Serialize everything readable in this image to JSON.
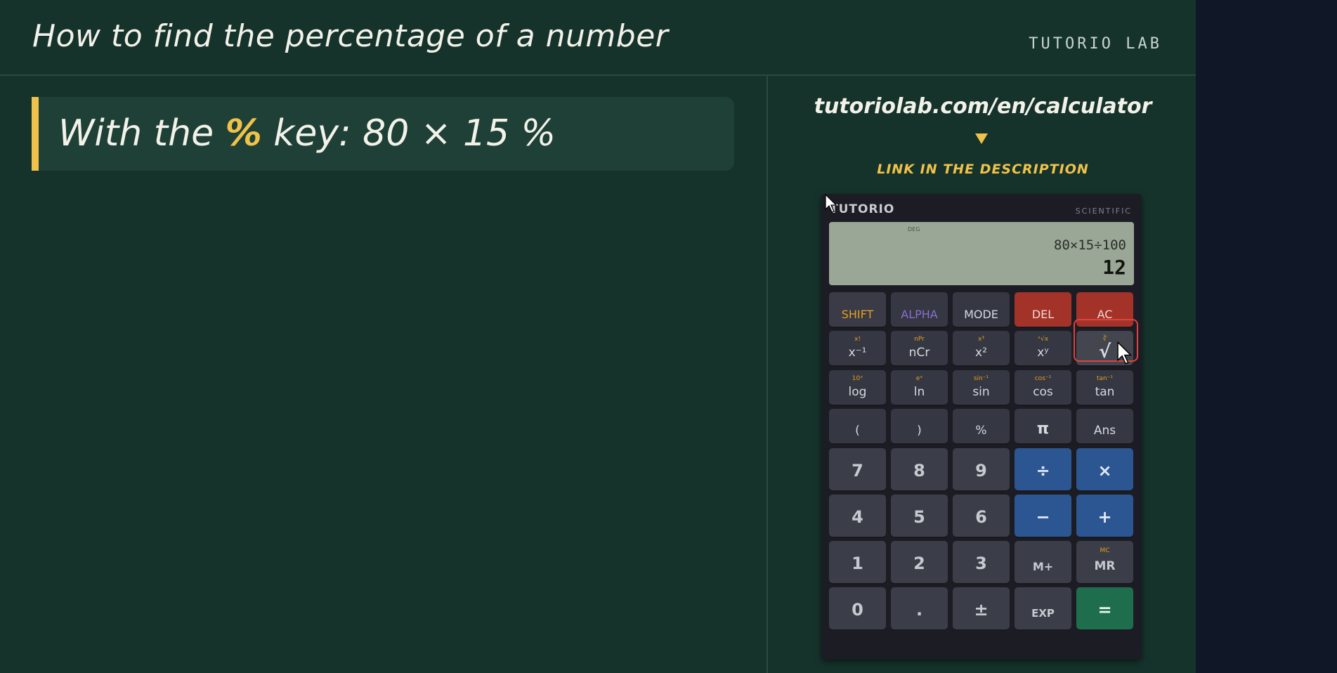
{
  "header": {
    "title": "How to find the percentage of a number",
    "brand": "TUTORIO LAB"
  },
  "formula": {
    "prefix": "With the ",
    "key": "%",
    "suffix": " key: 80 × 15 %"
  },
  "promo": {
    "url": "tutoriolab.com/en/calculator",
    "note": "LINK IN THE DESCRIPTION"
  },
  "calculator": {
    "brand": "TUTORIO",
    "model": "SCIENTIFIC",
    "display": {
      "mode": "DEG",
      "expression": "80×15÷100",
      "result": "12"
    },
    "keys": {
      "shift": "SHIFT",
      "alpha": "ALPHA",
      "mode": "MODE",
      "del": "DEL",
      "ac": "AC",
      "inverse": {
        "main": "x⁻¹",
        "sub": "x!"
      },
      "ncr": {
        "main": "nCr",
        "sub": "nPr"
      },
      "square": {
        "main": "x²",
        "sub": "x³"
      },
      "power": {
        "main": "xʸ",
        "sub": "ˣ√x"
      },
      "sqrt": {
        "main": "√",
        "sub": "∛"
      },
      "log": {
        "main": "log",
        "sub": "10ˣ"
      },
      "ln": {
        "main": "ln",
        "sub": "eˣ"
      },
      "sin": {
        "main": "sin",
        "sub": "sin⁻¹"
      },
      "cos": {
        "main": "cos",
        "sub": "cos⁻¹"
      },
      "tan": {
        "main": "tan",
        "sub": "tan⁻¹"
      },
      "lparen": "(",
      "rparen": ")",
      "percent": "%",
      "pi": "π",
      "ans": "Ans",
      "seven": "7",
      "eight": "8",
      "nine": "9",
      "divide": "÷",
      "multiply": "×",
      "four": "4",
      "five": "5",
      "six": "6",
      "minus": "−",
      "plus": "+",
      "one": "1",
      "two": "2",
      "three": "3",
      "mplus": "M+",
      "mr": {
        "main": "MR",
        "sub": "MC"
      },
      "zero": "0",
      "dot": ".",
      "negate": "±",
      "exp": "EXP",
      "equals": "="
    }
  }
}
